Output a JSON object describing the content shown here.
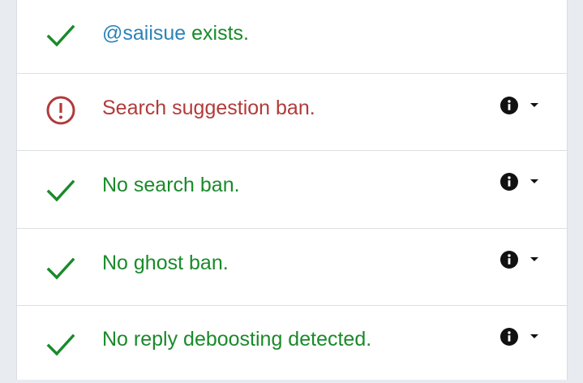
{
  "results": [
    {
      "status": "ok",
      "handle": "@saiisue",
      "text": " exists.",
      "icon": "check-icon",
      "has_actions": false
    },
    {
      "status": "bad",
      "text": "Search suggestion ban.",
      "icon": "alert-circle-icon",
      "has_actions": true
    },
    {
      "status": "ok",
      "text": "No search ban.",
      "icon": "check-icon",
      "has_actions": true
    },
    {
      "status": "ok",
      "text": "No ghost ban.",
      "icon": "check-icon",
      "has_actions": true
    },
    {
      "status": "ok",
      "text": "No reply deboosting detected.",
      "icon": "check-icon",
      "has_actions": true
    }
  ],
  "colors": {
    "ok": "#1a8a2a",
    "bad": "#b23a3a",
    "handle": "#2b83b6"
  },
  "action_icons": {
    "info": "info-icon",
    "expand": "caret-down-icon"
  }
}
